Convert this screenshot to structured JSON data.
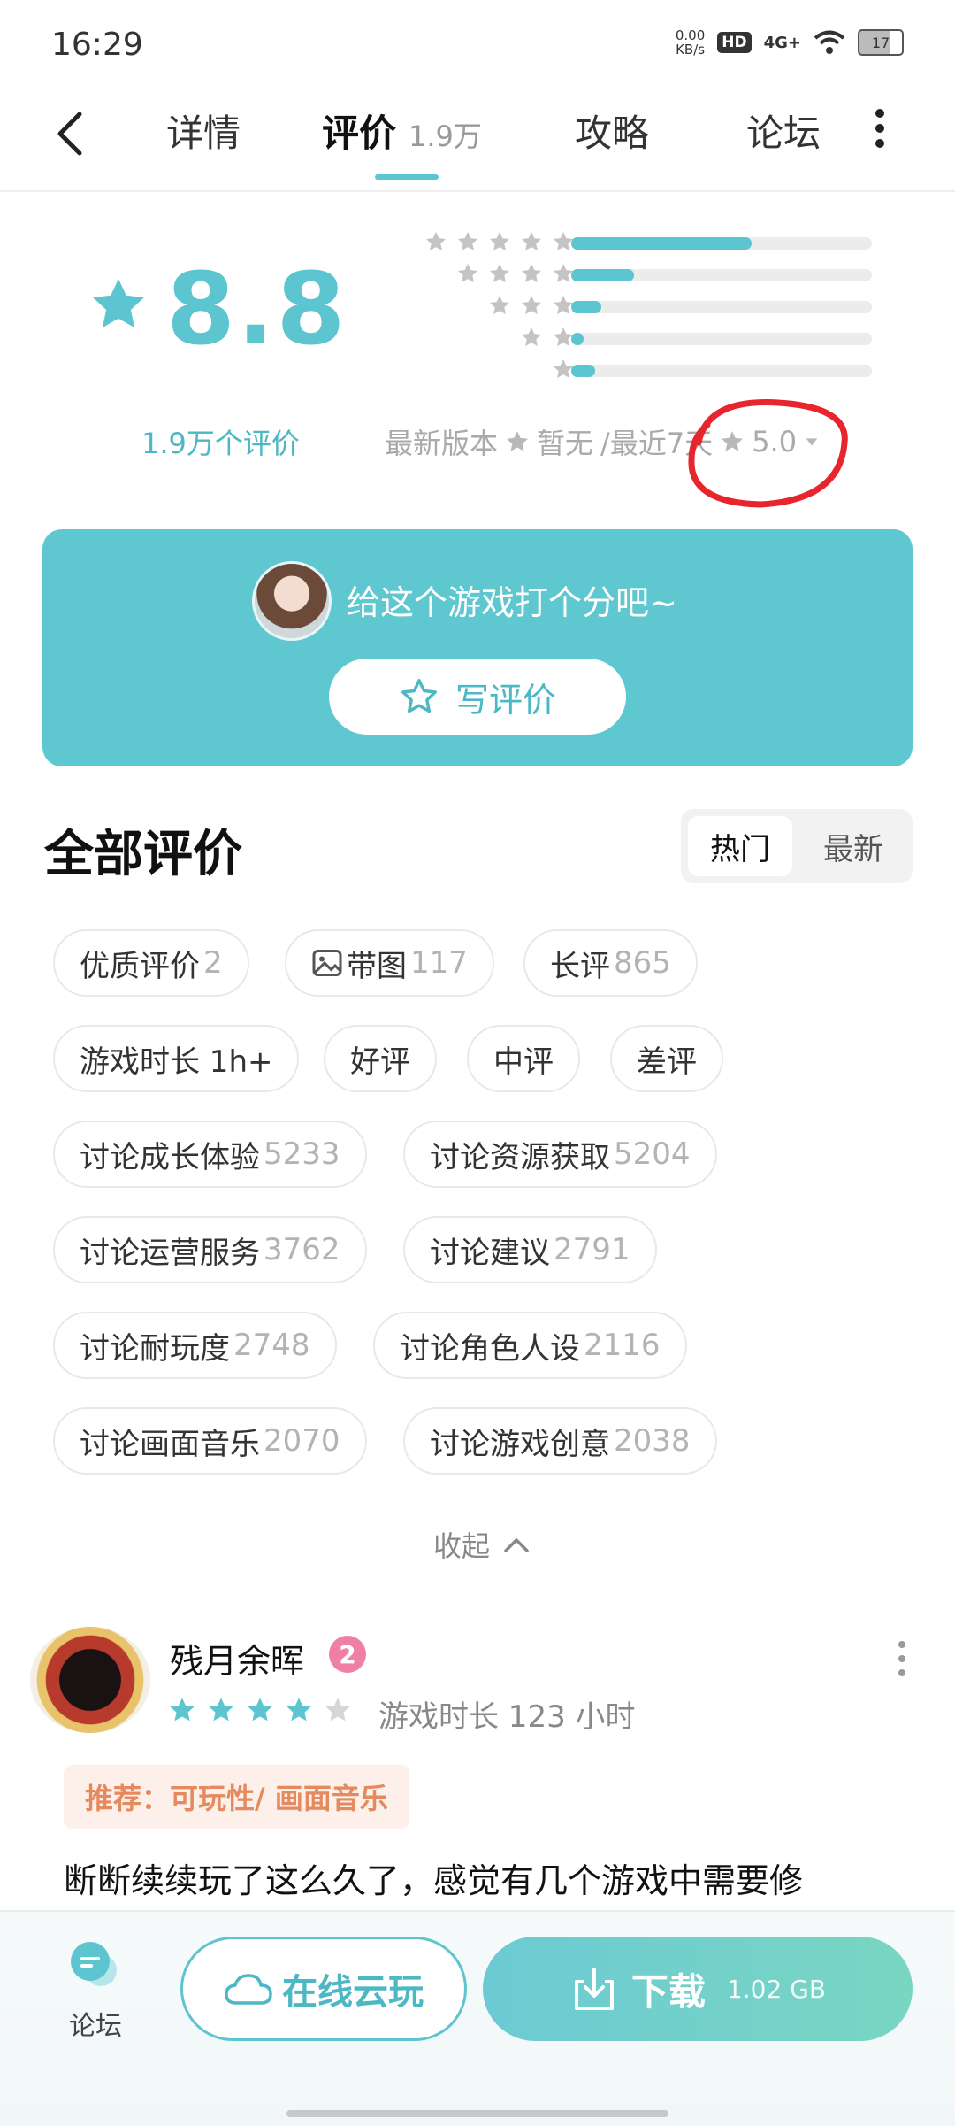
{
  "status_bar": {
    "time": "16:29",
    "speed_value": "0.00",
    "speed_unit": "KB/s",
    "hd": "HD",
    "network": "4G+",
    "battery": "17"
  },
  "nav": {
    "tabs": [
      {
        "label": "详情"
      },
      {
        "label": "评价",
        "count": "1.9万"
      },
      {
        "label": "攻略"
      },
      {
        "label": "论坛"
      }
    ]
  },
  "rating": {
    "score": "8.8",
    "count_text": "1.9万个评价",
    "distribution": [
      {
        "stars": 5,
        "fraction": 0.6
      },
      {
        "stars": 4,
        "fraction": 0.21
      },
      {
        "stars": 3,
        "fraction": 0.1
      },
      {
        "stars": 2,
        "fraction": 0.04
      },
      {
        "stars": 1,
        "fraction": 0.08
      }
    ],
    "latest_version_label": "最新版本",
    "latest_version_value": "暂无",
    "recent_label": "/最近7天",
    "recent_value": "5.0"
  },
  "banner": {
    "prompt": "给这个游戏打个分吧~",
    "write_button": "写评价"
  },
  "reviews_section": {
    "title": "全部评价",
    "sort_hot": "热门",
    "sort_new": "最新",
    "tags": [
      {
        "label": "优质评价",
        "count": "2"
      },
      {
        "label": "带图",
        "count": "117"
      },
      {
        "label": "长评",
        "count": "865"
      },
      {
        "label": "游戏时长 1h+",
        "count": ""
      },
      {
        "label": "好评",
        "count": ""
      },
      {
        "label": "中评",
        "count": ""
      },
      {
        "label": "差评",
        "count": ""
      },
      {
        "label": "讨论成长体验",
        "count": "5233"
      },
      {
        "label": "讨论资源获取",
        "count": "5204"
      },
      {
        "label": "讨论运营服务",
        "count": "3762"
      },
      {
        "label": "讨论建议",
        "count": "2791"
      },
      {
        "label": "讨论耐玩度",
        "count": "2748"
      },
      {
        "label": "讨论角色人设",
        "count": "2116"
      },
      {
        "label": "讨论画面音乐",
        "count": "2070"
      },
      {
        "label": "讨论游戏创意",
        "count": "2038"
      }
    ],
    "collapse": "收起"
  },
  "review": {
    "author": "残月余晖",
    "level": "2",
    "stars": 4,
    "play_time": "游戏时长 123 小时",
    "recommend": "推荐：可玩性/ 画面音乐",
    "text": "断断续续玩了这么久了，感觉有几个游戏中需要修"
  },
  "bottom": {
    "forum": "论坛",
    "cloud_play": "在线云玩",
    "download": "下载",
    "size": "1.02 GB"
  },
  "colors": {
    "accent": "#5cc5cf",
    "banner": "#5ec7cf",
    "recommend_text": "#e58a5e",
    "level_badge": "#f07fa6"
  }
}
